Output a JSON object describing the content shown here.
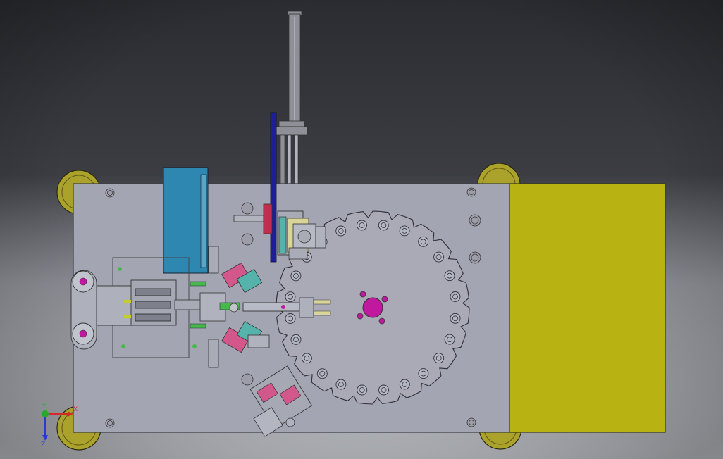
{
  "view": {
    "background": {
      "top": "#2b2c31",
      "bottom": "#cdd0d6"
    }
  },
  "colors": {
    "plate": "#a4a5b2",
    "plate_edge": "#3a3b45",
    "dial": "#a9aab6",
    "yellow_block": "#b8b313",
    "wheel": "#aaa22a",
    "blue_block": "#2e87b0",
    "navy_bar": "#1e1e9a",
    "magenta": "#c0199e",
    "teal": "#55b3ac",
    "pink": "#d2578a",
    "green": "#47b84a",
    "cream": "#d8d49a",
    "lime": "#c6cc2e",
    "red": "#c02d4e",
    "cylinder": "#8f8f98"
  },
  "dial": {
    "hole_count": 24,
    "notch_count": 24
  },
  "axis_triad": {
    "x_label": "X",
    "y_label": "Y",
    "z_label": "Z",
    "x_color": "#d42a2a",
    "y_color": "#2aa82a",
    "z_color": "#2a3ad4"
  }
}
